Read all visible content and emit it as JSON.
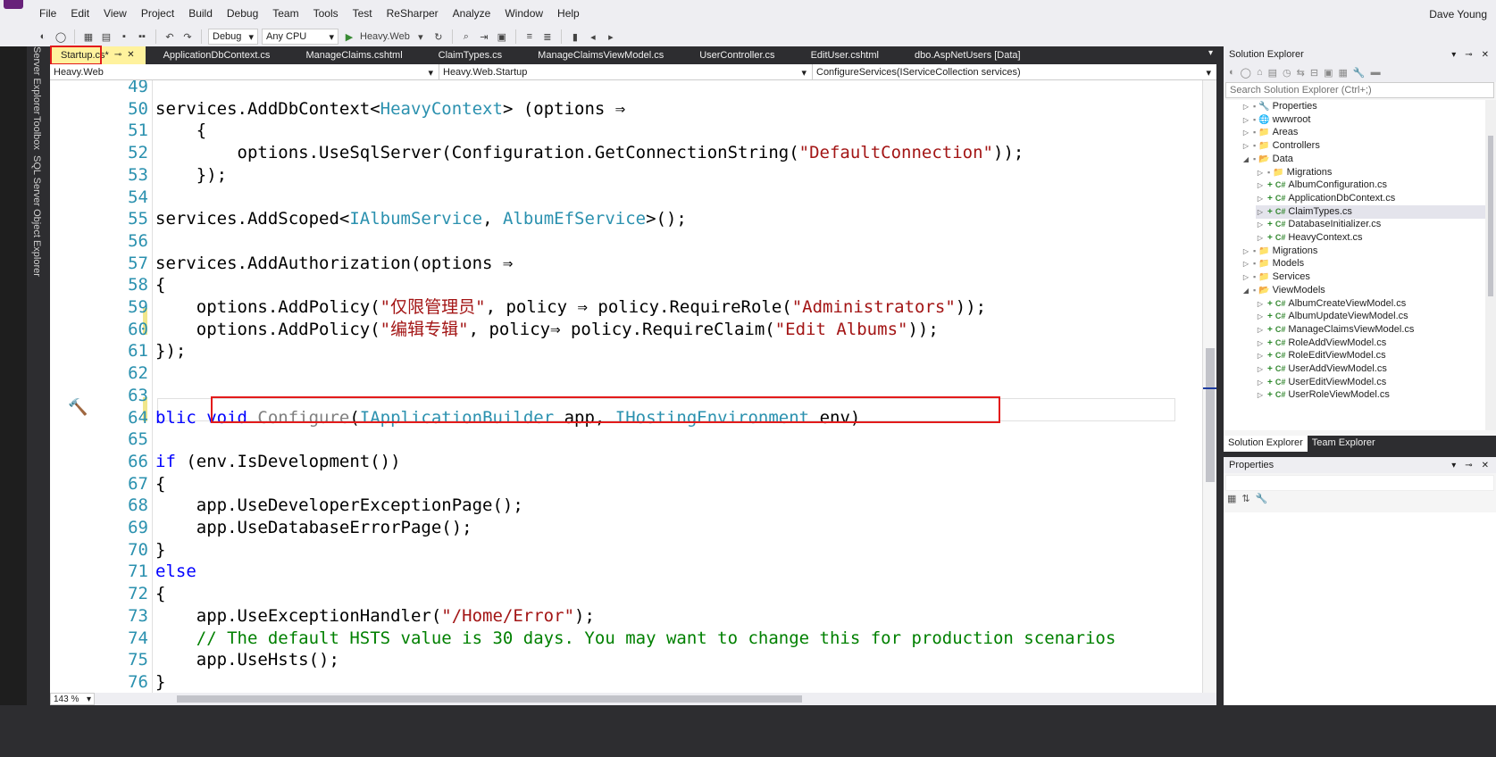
{
  "menu": {
    "items": [
      "File",
      "Edit",
      "View",
      "Project",
      "Build",
      "Debug",
      "Team",
      "Tools",
      "Test",
      "ReSharper",
      "Analyze",
      "Window",
      "Help"
    ],
    "user": "Dave Young"
  },
  "toolbar": {
    "config": "Debug",
    "platform": "Any CPU",
    "run_target": "Heavy.Web"
  },
  "left_strip": [
    "Server Explorer",
    "Toolbox",
    "SQL Server Object Explorer"
  ],
  "tabs": [
    {
      "label": "Startup.cs*",
      "active": true
    },
    {
      "label": "ApplicationDbContext.cs"
    },
    {
      "label": "ManageClaims.cshtml"
    },
    {
      "label": "ClaimTypes.cs"
    },
    {
      "label": "ManageClaimsViewModel.cs"
    },
    {
      "label": "UserController.cs"
    },
    {
      "label": "EditUser.cshtml"
    },
    {
      "label": "dbo.AspNetUsers [Data]"
    }
  ],
  "navbar": {
    "project": "Heavy.Web",
    "type": "Heavy.Web.Startup",
    "member": "ConfigureServices(IServiceCollection services)"
  },
  "editor": {
    "zoom": "143 %",
    "lines": [
      {
        "n": "49",
        "segs": []
      },
      {
        "n": "50",
        "segs": [
          [
            "",
            "services.AddDbContext<"
          ],
          [
            "ty",
            "HeavyContext"
          ],
          [
            "",
            "> (options ⇒"
          ]
        ]
      },
      {
        "n": "51",
        "segs": [
          [
            "",
            "    {"
          ]
        ]
      },
      {
        "n": "52",
        "segs": [
          [
            "",
            "        options.UseSqlServer(Configuration.GetConnectionString("
          ],
          [
            "st",
            "\"DefaultConnection\""
          ],
          [
            "",
            "));"
          ]
        ]
      },
      {
        "n": "53",
        "segs": [
          [
            "",
            "    });"
          ]
        ]
      },
      {
        "n": "54",
        "segs": []
      },
      {
        "n": "55",
        "segs": [
          [
            "",
            "services.AddScoped<"
          ],
          [
            "ty",
            "IAlbumService"
          ],
          [
            "",
            ", "
          ],
          [
            "ty",
            "AlbumEfService"
          ],
          [
            "",
            ">();"
          ]
        ]
      },
      {
        "n": "56",
        "segs": []
      },
      {
        "n": "57",
        "segs": [
          [
            "",
            "services.AddAuthorization(options ⇒"
          ]
        ]
      },
      {
        "n": "58",
        "segs": [
          [
            "",
            "{"
          ]
        ]
      },
      {
        "n": "59",
        "segs": [
          [
            "",
            "    options.AddPolicy("
          ],
          [
            "st",
            "\"仅限管理员\""
          ],
          [
            "",
            ", policy ⇒ policy.RequireRole("
          ],
          [
            "st",
            "\"Administrators\""
          ],
          [
            "",
            "));"
          ]
        ]
      },
      {
        "n": "60",
        "segs": [
          [
            "",
            "    options.AddPolicy("
          ],
          [
            "st",
            "\"编辑专辑\""
          ],
          [
            "",
            ", policy⇒ policy.RequireClaim("
          ],
          [
            "st",
            "\"Edit Albums\""
          ],
          [
            "",
            "));"
          ]
        ]
      },
      {
        "n": "61",
        "segs": [
          [
            "",
            "});"
          ]
        ]
      },
      {
        "n": "62",
        "segs": []
      },
      {
        "n": "63",
        "segs": []
      },
      {
        "n": "64",
        "segs": [
          [
            "kw",
            "blic void "
          ],
          [
            "gr",
            "Configure"
          ],
          [
            "",
            "("
          ],
          [
            "ty",
            "IApplicationBuilder"
          ],
          [
            "",
            " app, "
          ],
          [
            "ty",
            "IHostingEnvironment"
          ],
          [
            "",
            " env)"
          ]
        ]
      },
      {
        "n": "65",
        "segs": []
      },
      {
        "n": "66",
        "segs": [
          [
            "kw",
            "if"
          ],
          [
            "",
            " (env.IsDevelopment())"
          ]
        ]
      },
      {
        "n": "67",
        "segs": [
          [
            "",
            "{"
          ]
        ]
      },
      {
        "n": "68",
        "segs": [
          [
            "",
            "    app.UseDeveloperExceptionPage();"
          ]
        ]
      },
      {
        "n": "69",
        "segs": [
          [
            "",
            "    app.UseDatabaseErrorPage();"
          ]
        ]
      },
      {
        "n": "70",
        "segs": [
          [
            "",
            "}"
          ]
        ]
      },
      {
        "n": "71",
        "segs": [
          [
            "kw",
            "else"
          ]
        ]
      },
      {
        "n": "72",
        "segs": [
          [
            "",
            "{"
          ]
        ]
      },
      {
        "n": "73",
        "segs": [
          [
            "",
            "    app.UseExceptionHandler("
          ],
          [
            "st",
            "\"/Home/Error\""
          ],
          [
            "",
            ");"
          ]
        ]
      },
      {
        "n": "74",
        "segs": [
          [
            "cm",
            "    // The default HSTS value is 30 days. You may want to change this for production scenarios"
          ]
        ]
      },
      {
        "n": "75",
        "segs": [
          [
            "",
            "    app.UseHsts();"
          ]
        ]
      },
      {
        "n": "76",
        "segs": [
          [
            "",
            "}"
          ]
        ]
      }
    ]
  },
  "solution_explorer": {
    "title": "Solution Explorer",
    "search_placeholder": "Search Solution Explorer (Ctrl+;)",
    "nodes": [
      {
        "label": "Properties",
        "depth": 1,
        "arrow": "▷",
        "icon": "🔧"
      },
      {
        "label": "wwwroot",
        "depth": 1,
        "arrow": "▷",
        "icon": "🌐"
      },
      {
        "label": "Areas",
        "depth": 1,
        "arrow": "▷",
        "icon": "📁"
      },
      {
        "label": "Controllers",
        "depth": 1,
        "arrow": "▷",
        "icon": "📁"
      },
      {
        "label": "Data",
        "depth": 1,
        "arrow": "◢",
        "icon": "📂"
      },
      {
        "label": "Migrations",
        "depth": 2,
        "arrow": "▷",
        "icon": "📁"
      },
      {
        "label": "AlbumConfiguration.cs",
        "depth": 2,
        "arrow": "▷",
        "icon": "C#"
      },
      {
        "label": "ApplicationDbContext.cs",
        "depth": 2,
        "arrow": "▷",
        "icon": "C#"
      },
      {
        "label": "ClaimTypes.cs",
        "depth": 2,
        "arrow": "▷",
        "icon": "C#",
        "selected": true
      },
      {
        "label": "DatabaseInitializer.cs",
        "depth": 2,
        "arrow": "▷",
        "icon": "C#"
      },
      {
        "label": "HeavyContext.cs",
        "depth": 2,
        "arrow": "▷",
        "icon": "C#"
      },
      {
        "label": "Migrations",
        "depth": 1,
        "arrow": "▷",
        "icon": "📁"
      },
      {
        "label": "Models",
        "depth": 1,
        "arrow": "▷",
        "icon": "📁"
      },
      {
        "label": "Services",
        "depth": 1,
        "arrow": "▷",
        "icon": "📁"
      },
      {
        "label": "ViewModels",
        "depth": 1,
        "arrow": "◢",
        "icon": "📂"
      },
      {
        "label": "AlbumCreateViewModel.cs",
        "depth": 2,
        "arrow": "▷",
        "icon": "C#"
      },
      {
        "label": "AlbumUpdateViewModel.cs",
        "depth": 2,
        "arrow": "▷",
        "icon": "C#"
      },
      {
        "label": "ManageClaimsViewModel.cs",
        "depth": 2,
        "arrow": "▷",
        "icon": "C#"
      },
      {
        "label": "RoleAddViewModel.cs",
        "depth": 2,
        "arrow": "▷",
        "icon": "C#"
      },
      {
        "label": "RoleEditViewModel.cs",
        "depth": 2,
        "arrow": "▷",
        "icon": "C#"
      },
      {
        "label": "UserAddViewModel.cs",
        "depth": 2,
        "arrow": "▷",
        "icon": "C#"
      },
      {
        "label": "UserEditViewModel.cs",
        "depth": 2,
        "arrow": "▷",
        "icon": "C#"
      },
      {
        "label": "UserRoleViewModel.cs",
        "depth": 2,
        "arrow": "▷",
        "icon": "C#"
      }
    ],
    "bottom_tabs": [
      "Solution Explorer",
      "Team Explorer"
    ]
  },
  "properties": {
    "title": "Properties"
  },
  "colors": {
    "highlight_box": "#e31b1b",
    "active_tab": "#fff29d",
    "chrome_dark": "#2d2d30"
  }
}
